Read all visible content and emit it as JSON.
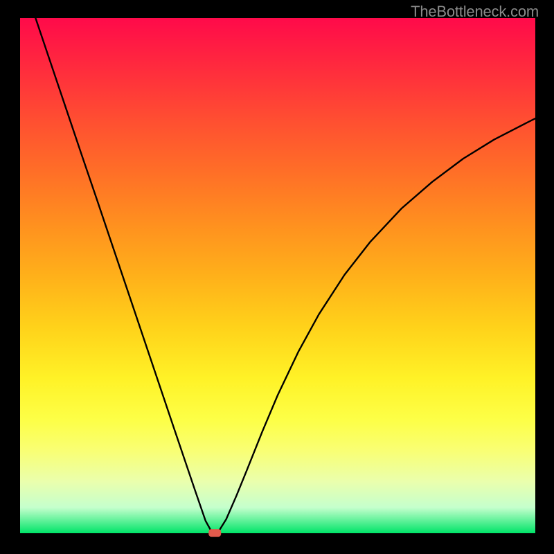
{
  "watermark": "TheBottleneck.com",
  "chart_data": {
    "type": "line",
    "title": "",
    "xlabel": "",
    "ylabel": "",
    "xlim": [
      0,
      100
    ],
    "ylim": [
      0,
      100
    ],
    "grid": false,
    "legend": false,
    "series": [
      {
        "name": "curve",
        "x": [
          3,
          6,
          9,
          12,
          15,
          18,
          21,
          24,
          27,
          30,
          32,
          34,
          36,
          37,
          37.8,
          38.5,
          40,
          42,
          44,
          47,
          50,
          54,
          58,
          63,
          68,
          74,
          80,
          86,
          92,
          98,
          100
        ],
        "y": [
          100,
          91.1,
          82.2,
          73.3,
          64.5,
          55.6,
          46.7,
          37.8,
          28.9,
          20,
          14.1,
          8.2,
          2.4,
          0.6,
          0.1,
          0.3,
          2.7,
          7.3,
          12.2,
          19.7,
          26.8,
          35.2,
          42.5,
          50.2,
          56.6,
          63.0,
          68.2,
          72.7,
          76.4,
          79.5,
          80.5
        ]
      }
    ],
    "marker": {
      "x": 37.8,
      "y": 0.05,
      "shape": "rounded-rect",
      "color": "#e15a4c"
    },
    "background_gradient_stops": [
      {
        "pos": 0,
        "color": "#ff0a4a"
      },
      {
        "pos": 50,
        "color": "#ffb01a"
      },
      {
        "pos": 78,
        "color": "#fdff47"
      },
      {
        "pos": 100,
        "color": "#00e468"
      }
    ]
  }
}
